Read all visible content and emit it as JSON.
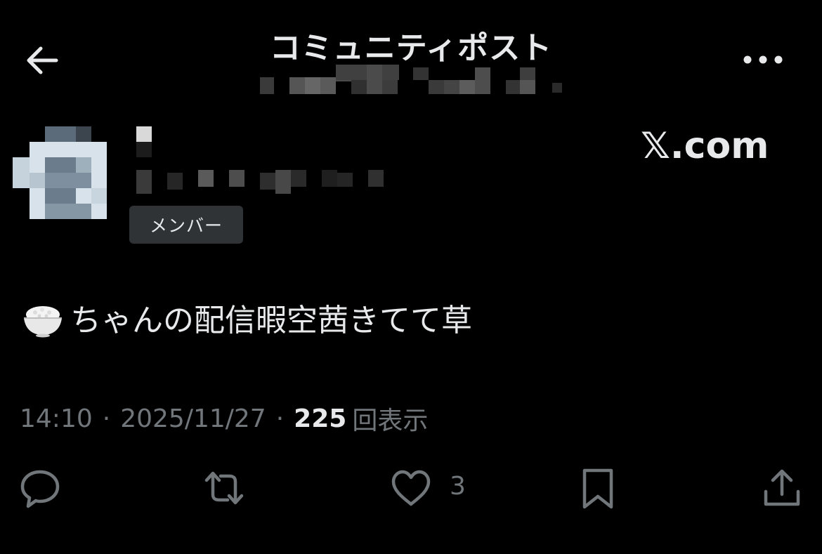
{
  "header": {
    "title": "コミュニティポスト",
    "back_icon": "arrow-left-icon",
    "more_icon": "more-horizontal-icon"
  },
  "post": {
    "member_badge": "メンバー",
    "watermark": "𝕏.com",
    "text": "ちゃんの配信暇空茜きてて草",
    "leading_emoji": "rice-bowl-emoji",
    "time": "14:10",
    "date": "2025/11/27",
    "separator": "·",
    "views_count": "225",
    "views_label": "回表示"
  },
  "actions": {
    "reply_icon": "reply-icon",
    "repost_icon": "repost-icon",
    "like_icon": "heart-icon",
    "like_count": "3",
    "bookmark_icon": "bookmark-icon",
    "share_icon": "share-icon"
  },
  "colors": {
    "background": "#000000",
    "text": "#e7e9ea",
    "secondary": "#71767b",
    "badge_bg": "#2f3336"
  }
}
